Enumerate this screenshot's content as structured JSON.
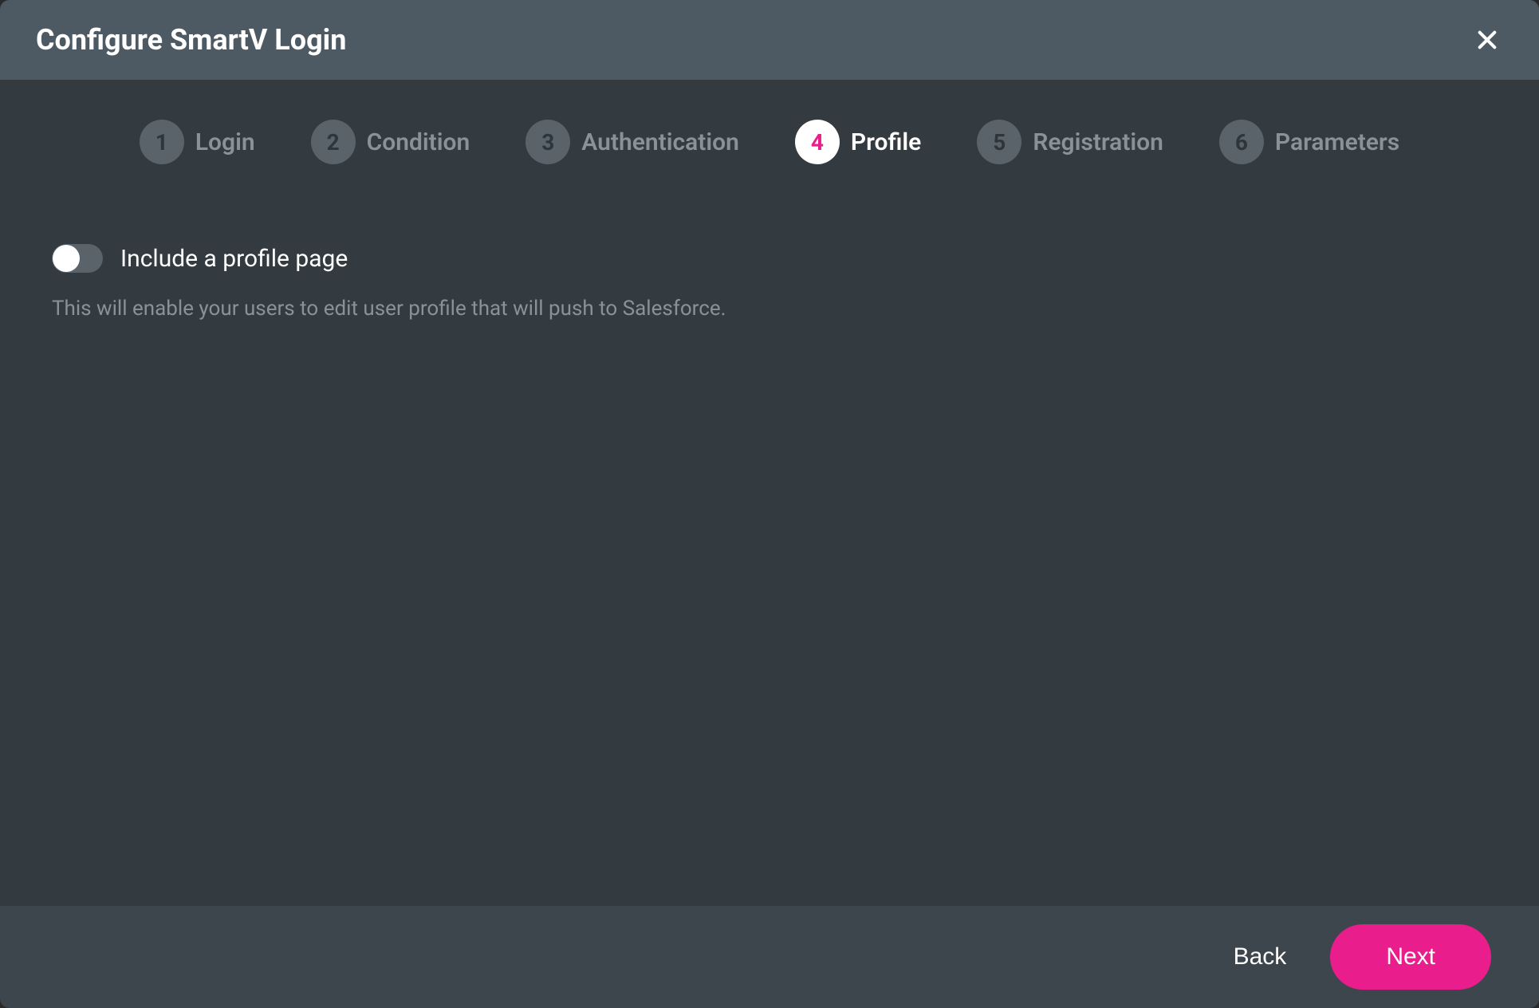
{
  "header": {
    "title": "Configure SmartV Login"
  },
  "stepper": {
    "steps": [
      {
        "number": "1",
        "label": "Login",
        "active": false
      },
      {
        "number": "2",
        "label": "Condition",
        "active": false
      },
      {
        "number": "3",
        "label": "Authentication",
        "active": false
      },
      {
        "number": "4",
        "label": "Profile",
        "active": true
      },
      {
        "number": "5",
        "label": "Registration",
        "active": false
      },
      {
        "number": "6",
        "label": "Parameters",
        "active": false
      }
    ]
  },
  "content": {
    "toggle_label": "Include a profile page",
    "toggle_state": "off",
    "description": "This will enable your users to edit user profile that will push to Salesforce."
  },
  "footer": {
    "back_label": "Back",
    "next_label": "Next"
  },
  "colors": {
    "accent": "#e91e8c",
    "header_bg": "#4d5a63",
    "body_bg": "#333a40",
    "footer_bg": "#3d464d"
  }
}
